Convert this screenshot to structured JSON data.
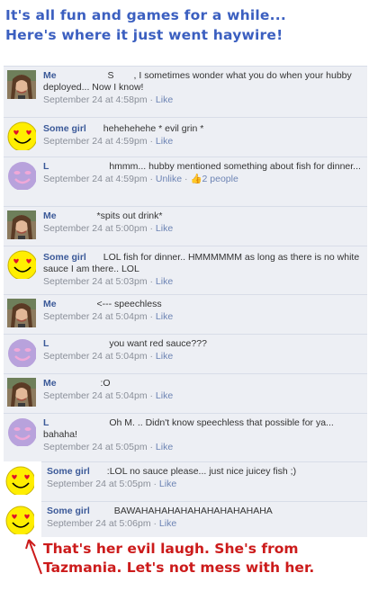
{
  "header": {
    "line1": "It's all fun and games for a while...",
    "line2": "Here's where it just went haywire!"
  },
  "comments": [
    {
      "avatar": "photo",
      "name": "Me",
      "redact": "S",
      "text": ", I sometimes wonder what you do when  your hubby deployed... Now I know!",
      "time": "September 24 at 4:58pm",
      "action": "Like"
    },
    {
      "avatar": "smiley",
      "name": "Some girl",
      "redact": "",
      "text": "hehehehehe * evil grin *",
      "time": "September 24 at 4:59pm",
      "action": "Like"
    },
    {
      "avatar": "purple",
      "name": "L",
      "redact": "",
      "text": "hmmm... hubby mentioned something about fish for dinner...",
      "time": "September 24 at 4:59pm",
      "action": "Unlike",
      "likes": "2 people"
    },
    {
      "avatar": "photo",
      "name": "Me",
      "redact": "",
      "text": "*spits out drink*",
      "time": "September 24 at 5:00pm",
      "action": "Like"
    },
    {
      "avatar": "smiley",
      "name": "Some girl",
      "redact": "",
      "text": "LOL fish for dinner.. HMMMMMM as long as there is no white sauce I am there.. LOL",
      "time": "September 24 at 5:03pm",
      "action": "Like"
    },
    {
      "avatar": "photo",
      "name": "Me",
      "redact": "",
      "text": "<--- speechless",
      "time": "September 24 at 5:04pm",
      "action": "Like"
    },
    {
      "avatar": "purple",
      "name": "L",
      "redact": "",
      "text": "you want red sauce???",
      "time": "September 24 at 5:04pm",
      "action": "Like"
    },
    {
      "avatar": "photo",
      "name": "Me",
      "redact": "",
      "text": ":O",
      "time": "September 24 at 5:04pm",
      "action": "Like"
    },
    {
      "avatar": "purple",
      "name": "L",
      "redact": "",
      "text": "Oh M.     .. Didn't know speechless that possible for ya... bahaha!",
      "time": "September 24 at 5:05pm",
      "action": "Like"
    },
    {
      "avatar": "smiley",
      "name": "Some girl",
      "redact": "",
      "text": ":LOL no sauce please... just nice juicey fish ;)",
      "time": "September 24 at 5:05pm",
      "action": "Like"
    },
    {
      "avatar": "smiley",
      "name": "Some girl",
      "redact": "",
      "text": "BAWAHAHAHAHAHAHAHAHAHAHA",
      "time": "September 24 at 5:06pm",
      "action": "Like"
    }
  ],
  "annotation": {
    "line1": "That's her evil laugh. She's from",
    "line2": "Tazmania. Let's not mess with her."
  },
  "colors": {
    "header": "#3b5fc0",
    "annotation": "#cc1b1b",
    "name": "#3b5998",
    "comment_bg": "#edeff4",
    "smiley": "#ffee00",
    "purple_face": "#b8a2dc"
  }
}
